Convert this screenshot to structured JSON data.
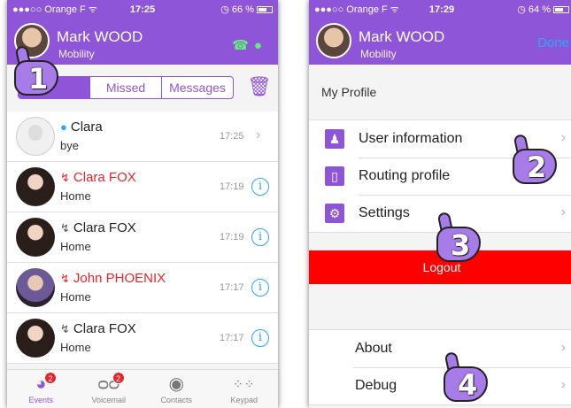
{
  "left": {
    "status": {
      "carrier": "●●●○○ Orange F ᯤ",
      "time": "17:25",
      "battery": "◷ 66 %",
      "battery_level": 0.66
    },
    "user": {
      "name": "Mark WOOD",
      "subtitle": "Mobility"
    },
    "filter_tabs": [
      "",
      "Missed",
      "Messages"
    ],
    "events": [
      {
        "name": "Clara",
        "detail": "bye",
        "time": "17:25",
        "kind": "message",
        "missed": false,
        "action": "chevron"
      },
      {
        "name": "Clara FOX",
        "detail": "Home",
        "time": "17:19",
        "kind": "call",
        "missed": true,
        "action": "info"
      },
      {
        "name": "Clara FOX",
        "detail": "Home",
        "time": "17:19",
        "kind": "call",
        "missed": false,
        "action": "info"
      },
      {
        "name": "John PHOENIX",
        "detail": "Home",
        "time": "17:17",
        "kind": "call",
        "missed": true,
        "action": "info"
      },
      {
        "name": "Clara FOX",
        "detail": "Home",
        "time": "17:17",
        "kind": "call",
        "missed": false,
        "action": "info"
      }
    ],
    "tabbar": [
      {
        "label": "Events",
        "icon": "events-icon",
        "badge": "2"
      },
      {
        "label": "Voicemail",
        "icon": "voicemail-icon",
        "badge": "2"
      },
      {
        "label": "Contacts",
        "icon": "contacts-icon",
        "badge": ""
      },
      {
        "label": "Keypad",
        "icon": "keypad-icon",
        "badge": ""
      }
    ],
    "hand_number": "1"
  },
  "right": {
    "status": {
      "carrier": "●●●○○ Orange F ᯤ",
      "time": "17:29",
      "battery": "◷ 64 %",
      "battery_level": 0.64
    },
    "user": {
      "name": "Mark WOOD",
      "subtitle": "Mobility"
    },
    "done_label": "Done",
    "section_title": "My Profile",
    "profile_items": [
      {
        "label": "User information",
        "icon": "user-icon"
      },
      {
        "label": "Routing profile",
        "icon": "phone-icon"
      },
      {
        "label": "Settings",
        "icon": "gear-icon"
      }
    ],
    "logout_label": "Logout",
    "other_items": [
      "About",
      "Debug"
    ],
    "hand_numbers": [
      "2",
      "3",
      "4"
    ]
  },
  "colors": {
    "accent": "#8f55d8",
    "missed": "#e8232c",
    "link": "#29a8ff",
    "logout": "#ff0000"
  }
}
